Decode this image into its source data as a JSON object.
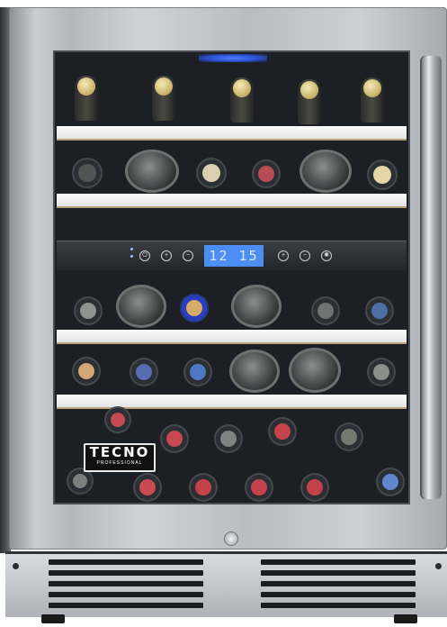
{
  "product": {
    "brand": "TECNO",
    "brand_subtitle": "PROFESSIONAL",
    "display_readout": "12  15",
    "colors": {
      "stainless": "#c4c7cb",
      "glass": "#1c1f23",
      "display": "#4d8ef2",
      "rack": "#f2f2f2",
      "glow": "#3d6bff"
    }
  },
  "control_panel": {
    "buttons": [
      "power-icon",
      "plus-icon",
      "minus-icon",
      "plus-icon",
      "minus-icon",
      "light-icon"
    ]
  }
}
